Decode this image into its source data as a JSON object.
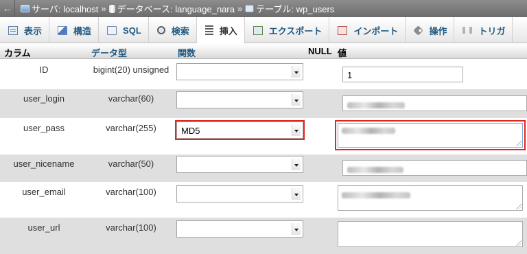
{
  "breadcrumb": {
    "back": "←",
    "server": "サーバ: localhost",
    "separator": "»",
    "database": "データベース: language_nara",
    "table": "テーブル: wp_users"
  },
  "tabs": [
    {
      "label": "表示",
      "icon": "browse-icon",
      "active": false
    },
    {
      "label": "構造",
      "icon": "structure-icon",
      "active": false
    },
    {
      "label": "SQL",
      "icon": "sql-icon",
      "active": false
    },
    {
      "label": "検索",
      "icon": "search-icon",
      "active": false
    },
    {
      "label": "挿入",
      "icon": "insert-icon",
      "active": true
    },
    {
      "label": "エクスポート",
      "icon": "export-icon",
      "active": false
    },
    {
      "label": "インポート",
      "icon": "import-icon",
      "active": false
    },
    {
      "label": "操作",
      "icon": "operations-icon",
      "active": false
    },
    {
      "label": "トリガ",
      "icon": "triggers-icon",
      "active": false
    }
  ],
  "table_header": {
    "column": "カラム",
    "type": "データ型",
    "function": "関数",
    "null": "NULL",
    "value": "値"
  },
  "rows": [
    {
      "name": "ID",
      "type": "bigint(20) unsigned",
      "function": "",
      "value": "1",
      "value_kind": "input",
      "value_blurred": false
    },
    {
      "name": "user_login",
      "type": "varchar(60)",
      "function": "",
      "value": "",
      "value_kind": "input",
      "value_blurred": true
    },
    {
      "name": "user_pass",
      "type": "varchar(255)",
      "function": "MD5",
      "value": "",
      "value_kind": "textarea",
      "value_blurred": true,
      "highlighted": true
    },
    {
      "name": "user_nicename",
      "type": "varchar(50)",
      "function": "",
      "value": "",
      "value_kind": "input",
      "value_blurred": true
    },
    {
      "name": "user_email",
      "type": "varchar(100)",
      "function": "",
      "value": "",
      "value_kind": "textarea",
      "value_blurred": true
    },
    {
      "name": "user_url",
      "type": "varchar(100)",
      "function": "",
      "value": "",
      "value_kind": "textarea",
      "value_blurred": false
    }
  ],
  "colors": {
    "highlight": "#e0271f",
    "tab_text": "#235a81",
    "row_alt": "#dfdfdf"
  }
}
